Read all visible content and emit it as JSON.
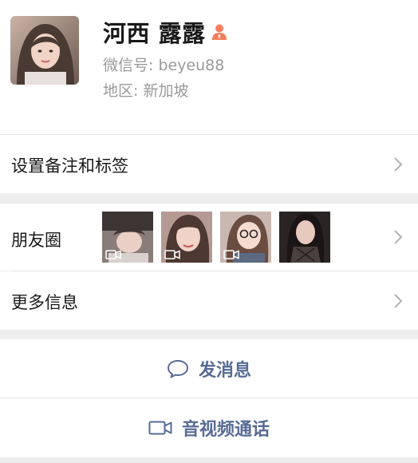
{
  "profile": {
    "display_name": "河西 露露",
    "wechat_id_label": "微信号: beyeu88",
    "region_label": "地区: 新加坡",
    "gender": "female",
    "gender_color": "#f37e5e"
  },
  "rows": {
    "remark_tags": "设置备注和标签",
    "moments": "朋友圈",
    "more_info": "更多信息"
  },
  "moments_thumbnails": [
    {
      "is_video": true
    },
    {
      "is_video": true
    },
    {
      "is_video": true
    },
    {
      "is_video": false
    }
  ],
  "actions": {
    "send_message": "发消息",
    "video_call": "音视频通话"
  },
  "colors": {
    "link_blue": "#576b95",
    "background": "#ededed",
    "chevron": "#b2b2b2"
  },
  "icons": {
    "gender": "female-person-icon",
    "chevron": "chevron-right-icon",
    "message": "chat-bubble-icon",
    "video": "video-camera-icon"
  }
}
